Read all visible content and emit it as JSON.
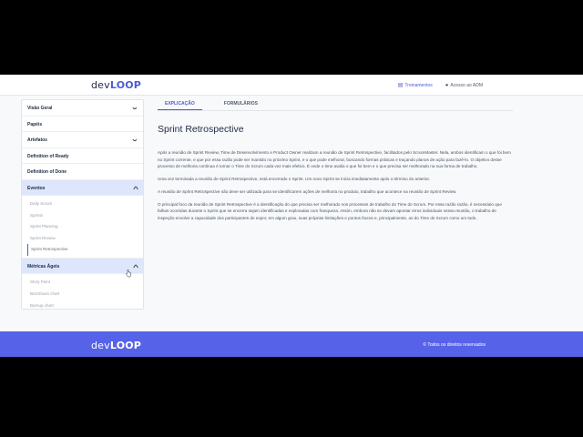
{
  "header": {
    "logo_prefix": "dev",
    "logo_suffix": "LOOP",
    "link_trainings": "Treinamentos",
    "link_admin": "Acesso ao ADM"
  },
  "sidebar": {
    "items": [
      {
        "label": "Visão Geral"
      },
      {
        "label": "Papéis"
      },
      {
        "label": "Artefatos"
      },
      {
        "label": "Definition of Ready"
      },
      {
        "label": "Definition of Done"
      },
      {
        "label": "Eventos"
      },
      {
        "label": "Métricas Ágeis"
      }
    ],
    "eventos_sub": [
      "Daily Scrum",
      "Sprints",
      "Sprint Planning",
      "Sprint Review",
      "Sprint Retrospective"
    ],
    "metricas_sub": [
      "Story Point",
      "BurnDown chart",
      "Burnup chart"
    ]
  },
  "tabs": [
    {
      "label": "EXPLICAÇÃO"
    },
    {
      "label": "FORMULÁRIOS"
    }
  ],
  "main": {
    "title": "Sprint Retrospective",
    "paragraphs": [
      "Após a reunião de Sprint Review, Time de Desenvolvimento e Product Owner realizam a reunião de Sprint Retrospective, facilitados pelo ScrumMaster. Nela, ambos identificam o que foi bem no Sprint corrente, e que por essa razão pode ser mantido no próximo Sprint, e o que pode melhorar, buscando formas práticas e traçando planos de ação para fazê-lo. O objetivo desse processo de melhoria contínua é tornar o Time do Scrum cada vez mais efetivo. É onde o time avalia o que foi bem e o que precisa ser melhorado na sua forma de trabalho.",
      "Uma vez terminada a reunião de Sprint Retrospective, está encerrado o Sprint. Um novo Sprint se inicia imediatamente após o término do anterior.",
      "A reunião de Sprint Retrospective não deve ser utilizada para se identificarem ações de melhoria no produto, trabalho que acontece na reunião de Sprint Review.",
      "O principal foco da reunião de Sprint Retrospective é a identificação do que precisa ser melhorado nos processos de trabalho do Time do Scrum. Por essa razão razão, é necessário que falhas ocorridas durante o Sprint que se encerra sejam identificadas e exploradas com franqueza. Assim, embora não se devam apontar erros individuais nessa reunião, o trabalho de inspeção envolve a capacidade dos participantes de expor, em algum grau, suas próprias limitações e pontos fracos e, principalmente, as do Time de Scrum como um todo."
    ]
  },
  "footer": {
    "copyright": "© Todos os direitos reservados"
  }
}
